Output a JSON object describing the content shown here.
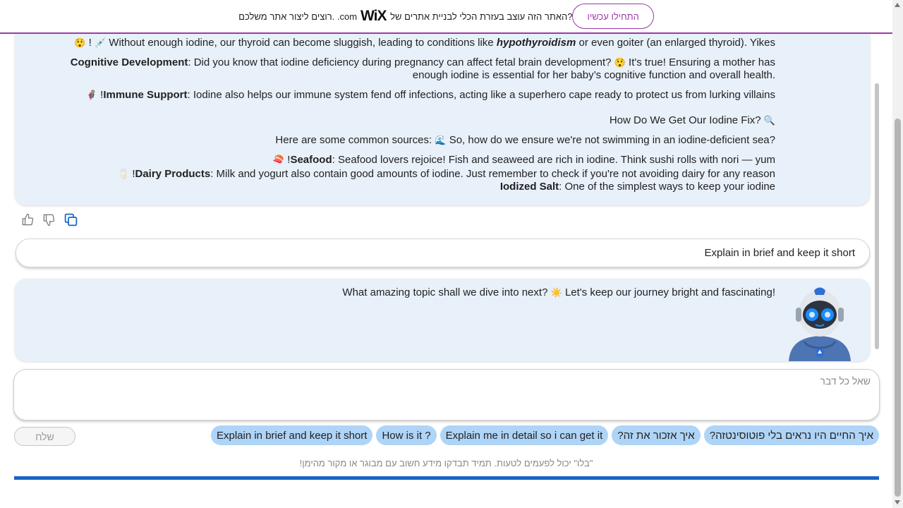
{
  "wix_banner": {
    "prefix": "האתר הזה עוצב בעזרת הכלי לבניית אתרים של",
    "logo": "WiX",
    "logo_suffix": ".com",
    "question_mark": "?",
    "suffix": "רוצים ליצור אתר משלכם",
    "start_button": "התחילו עכשיו",
    "accent_color": "#9b3aa8"
  },
  "bot_message_1": {
    "line1_pre": "Without enough iodine, our thyroid can become sluggish, leading to conditions like",
    "line1_term": "hypothyroidism",
    "line1_post": "or even goiter (an enlarged thyroid). Yikes",
    "line1_end": "!",
    "line2_term": "Cognitive Development",
    "line2_text": ": Did you know that iodine deficiency during pregnancy can affect fetal brain development?",
    "line2_text2": "It's true! Ensuring a mother has",
    "line3_text": "enough iodine is essential for her baby’s cognitive function and overall health.",
    "line4_term": "Immune Support",
    "line4_text": ": Iodine also helps our immune system fend off infections, acting like a superhero cape ready to protect us from lurking villains",
    "line4_end": "!",
    "line5_text": "How Do We Get Our Iodine Fix?",
    "line6_text": "Here are some common sources:",
    "line6_pre": "So, how do we ensure we're not swimming in an iodine-deficient sea?",
    "line7_term": "Seafood",
    "line7_text": ": Seafood lovers rejoice! Fish and seaweed are rich in iodine. Think sushi rolls with nori — yum",
    "line7_end": "!",
    "line8_term": "Dairy Products",
    "line8_text": ": Milk and yogurt also contain good amounts of iodine. Just remember to check if you're not avoiding dairy for any reason",
    "line8_end": "!",
    "line9_term": "Iodized Salt",
    "line9_text": ": One of the simplest ways to keep your iodine"
  },
  "reactions": {
    "like_icon": "thumbs-up-icon",
    "dislike_icon": "thumbs-down-icon",
    "copy_icon": "copy-icon",
    "copy_color": "#1a63c7"
  },
  "user_message": {
    "text": "Explain in brief and keep it short"
  },
  "bot_message_2": {
    "text_pre": "Let's keep our journey bright and fascinating!",
    "text_post": "What amazing topic shall we dive into next?"
  },
  "input": {
    "placeholder": "שאל כל דבר",
    "value": ""
  },
  "send_button": {
    "label": "שלח"
  },
  "suggestions": [
    "Explain in brief and keep it short",
    "How is it ?",
    "Explain me in detail so i can get it",
    "איך אזכור את זה?",
    "איך החיים היו נראים בלי פוטוסינטזה?"
  ],
  "disclaimer": "\"בלו\" יכול לפעמים לטעות. תמיד תבדקו מידע חשוב עם מבוגר או מקור מהימן!",
  "colors": {
    "bubble_bg": "#e8f0f9",
    "chip_bg": "#aed4f7",
    "bottom_bar": "#1a63c7"
  }
}
